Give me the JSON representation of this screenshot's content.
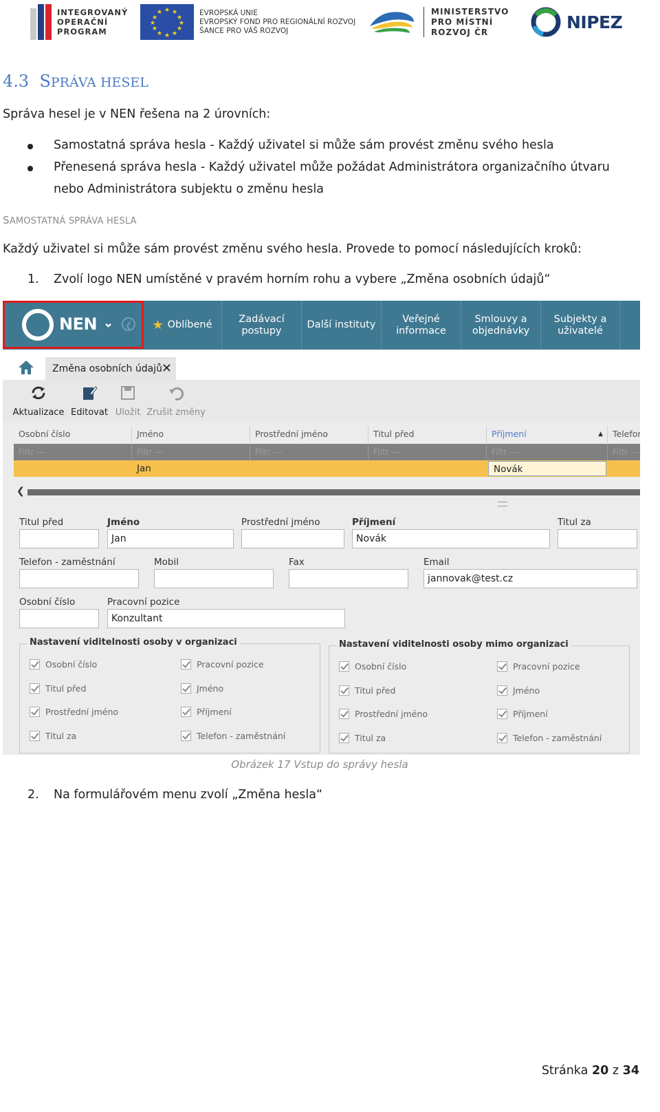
{
  "header_logos": {
    "iop": "INTEGROVANÝ\nOPERAČNÍ\nPROGRAM",
    "eu": "EVROPSKÁ UNIE\nEVROPSKÝ FOND PRO REGIONÁLNÍ ROZVOJ\nŠANCE PRO VÁŠ ROZVOJ",
    "mmr": "MINISTERSTVO\nPRO MÍSTNÍ\nROZVOJ ČR",
    "nipez": "NIPEZ"
  },
  "heading": {
    "number": "4.3",
    "first_letter": "S",
    "rest": "PRÁVA HESEL"
  },
  "intro": "Správa hesel je v NEN řešena na 2 úrovních:",
  "bullets": [
    "Samostatná správa hesla - Každý uživatel si může sám provést změnu svého hesla",
    "Přenesená správa hesla - Každý uživatel může požádat Administrátora organizačního útvaru",
    "nebo Administrátora subjektu o změnu hesla"
  ],
  "subheading": {
    "first_letter": "S",
    "rest": "AMOSTATNÁ SPRÁVA HESLA"
  },
  "para": "Každý uživatel si může sám provést změnu svého hesla. Provede to pomocí následujících kroků:",
  "steps": [
    {
      "num": "1.",
      "text": "Zvolí logo NEN umístěné v pravém horním rohu a vybere „Změna osobních údajů“"
    },
    {
      "num": "2.",
      "text": "Na formulářovém menu zvolí „Změna hesla“"
    }
  ],
  "screenshot": {
    "logo": "NEN",
    "nav": [
      "Oblíbené",
      "Zadávací\npostupy",
      "Další instituty",
      "Veřejné\ninformace",
      "Smlouvy a\nobjednávky",
      "Subjekty a\nuživatelé"
    ],
    "tab": "Změna osobních údajů",
    "toolbar": [
      "Aktualizace",
      "Editovat",
      "Uložit",
      "Zrušit změny"
    ],
    "grid_headers": [
      "Osobní číslo",
      "Jméno",
      "Prostřední jméno",
      "Titul před",
      "Příjmení",
      "Telefon"
    ],
    "filter_text": "Filtr ---",
    "grid_row": {
      "jmeno": "Jan",
      "prijmeni": "Novák"
    },
    "form": {
      "titul_pred": "Titul před",
      "jmeno_label": "Jméno",
      "jmeno_value": "Jan",
      "prostredni": "Prostřední jméno",
      "prijmeni_label": "Příjmení",
      "prijmeni_value": "Novák",
      "titul_za": "Titul za",
      "telefon": "Telefon - zaměstnání",
      "mobil": "Mobil",
      "fax": "Fax",
      "email_label": "Email",
      "email_value": "jannovak@test.cz",
      "osobni_cislo": "Osobní číslo",
      "pozice_label": "Pracovní pozice",
      "pozice_value": "Konzultant"
    },
    "visibility_in": {
      "title": "Nastavení viditelnosti osoby v organizaci",
      "left": [
        "Osobní číslo",
        "Titul před",
        "Prostřední jméno",
        "Titul za"
      ],
      "right": [
        "Pracovní pozice",
        "Jméno",
        "Příjmení",
        "Telefon - zaměstnání"
      ]
    },
    "visibility_out": {
      "title": "Nastavení viditelnosti osoby mimo organizaci",
      "left": [
        "Osobní číslo",
        "Titul před",
        "Prostřední jméno",
        "Titul za"
      ],
      "right": [
        "Pracovní pozice",
        "Jméno",
        "Příjmení",
        "Telefon - zaměstnání"
      ]
    }
  },
  "caption": "Obrázek 17 Vstup do správy hesla",
  "footer": {
    "prefix": "Stránka",
    "page": "20",
    "sep": "z",
    "total": "34"
  },
  "colors": {
    "accent": "#4e7cc2",
    "nav": "#3f7891",
    "highlight": "#f6c04d",
    "red_frame": "#e11d1d"
  }
}
